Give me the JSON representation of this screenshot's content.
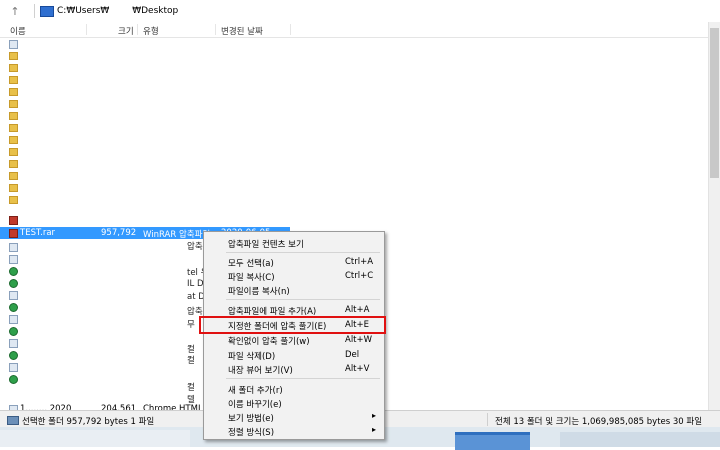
{
  "address": {
    "path": "C:₩Users₩        ₩Desktop"
  },
  "columns": {
    "name": "이름",
    "size": "크기",
    "type": "유형",
    "date": "변경된 날짜"
  },
  "files": {
    "selected": {
      "name": "TEST.rar",
      "size": "957,792",
      "type": "WinRAR 압축파일",
      "date": "2020-06-05"
    },
    "last": {
      "name": "1........ 2020",
      "size": "204,561",
      "type": "Chrome HTML D"
    }
  },
  "type_fragments": [
    "압축",
    "tel 우",
    "IL D",
    "at D",
    "압축",
    "무",
    "컬",
    "컬",
    "컬",
    "텔"
  ],
  "context_menu": {
    "items": [
      {
        "label": "압축파일 컨텐츠 보기",
        "shortcut": ""
      },
      {
        "label": "모두 선택(a)",
        "shortcut": "Ctrl+A"
      },
      {
        "label": "파일 복사(C)",
        "shortcut": "Ctrl+C"
      },
      {
        "label": "파일이름 복사(n)",
        "shortcut": ""
      },
      {
        "label": "압축파일에 파일 추가(A)",
        "shortcut": "Alt+A"
      },
      {
        "label": "지정한 폴더에 압축 풀기(E)",
        "shortcut": "Alt+E"
      },
      {
        "label": "확인없이 압축 풀기(w)",
        "shortcut": "Alt+W"
      },
      {
        "label": "파일 삭제(D)",
        "shortcut": "Del"
      },
      {
        "label": "내장 뷰어 보기(V)",
        "shortcut": "Alt+V"
      },
      {
        "label": "새 폴더 추가(r)",
        "shortcut": ""
      },
      {
        "label": "이름 바꾸기(e)",
        "shortcut": ""
      },
      {
        "label": "보기 방법(e)",
        "shortcut": ""
      },
      {
        "label": "정렬 방식(S)",
        "shortcut": ""
      }
    ],
    "highlighted_color": "#e01010"
  },
  "status": {
    "left": "선택한 폴더 957,792 bytes 1 파일",
    "right": "전체 13 폴더 및 크기는 1,069,985,085 bytes 30 파일"
  },
  "colors": {
    "selection": "#3399ff",
    "folder": "#e8c04a"
  }
}
